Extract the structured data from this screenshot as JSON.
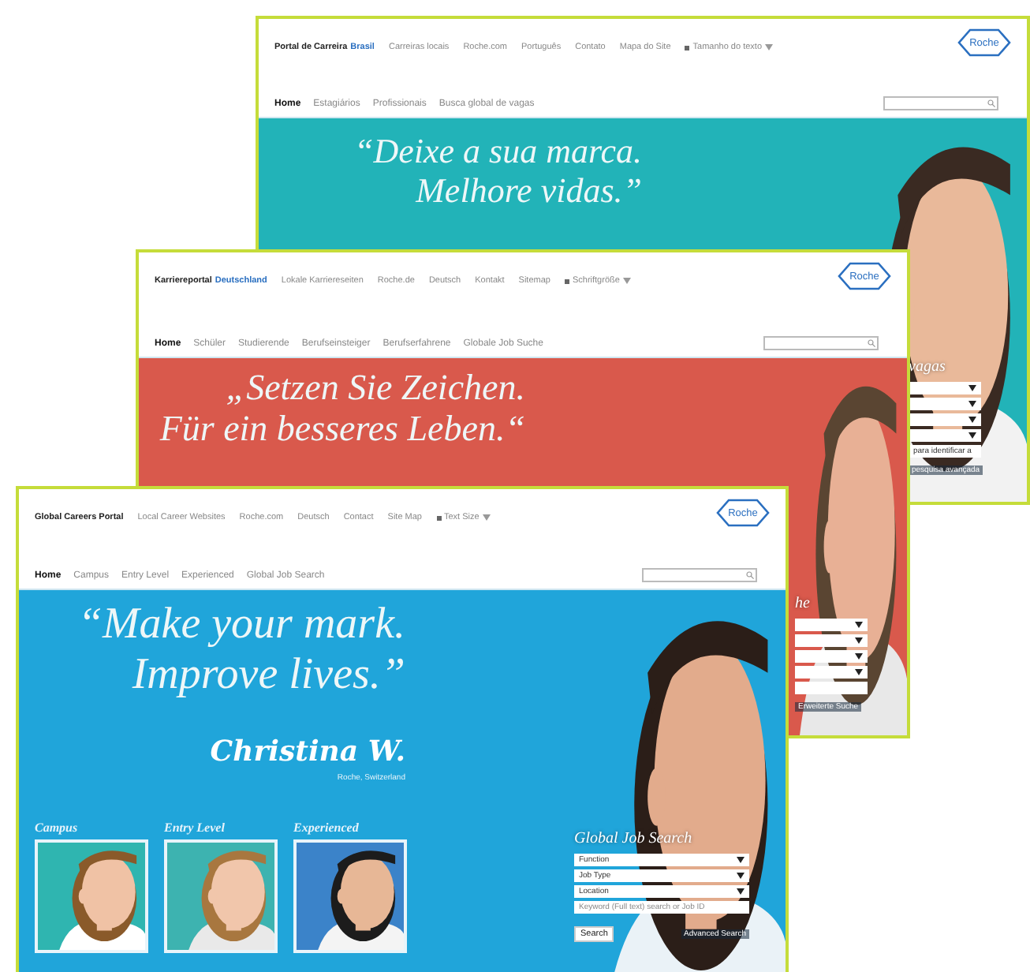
{
  "windows": [
    {
      "portal": "Portal de Carreira",
      "country": "Brasil",
      "top_links": [
        "Carreiras locais",
        "Roche.com",
        "Português",
        "Contato",
        "Mapa do Site"
      ],
      "text_size": "Tamanho do texto",
      "logo": "Roche",
      "nav_tabs": [
        {
          "label": "Home",
          "selected": true
        },
        {
          "label": "Estagiários",
          "selected": false
        },
        {
          "label": "Profissionais",
          "selected": false
        },
        {
          "label": "Busca global de vagas",
          "selected": false
        }
      ],
      "banner": {
        "color": "#22b3b8",
        "quote": [
          "“Deixe a sua marca.",
          "Melhore vidas.”"
        ],
        "job_search": {
          "heading": "vagas",
          "fields": [
            {
              "kind": "dropdown"
            },
            {
              "kind": "dropdown"
            },
            {
              "kind": "dropdown"
            },
            {
              "kind": "dropdown"
            },
            {
              "kind": "text",
              "value": "para identificar a"
            }
          ],
          "link": "pesquisa avançada"
        }
      }
    },
    {
      "portal": "Karriereportal",
      "country": "Deutschland",
      "top_links": [
        "Lokale Karriereseiten",
        "Roche.de",
        "Deutsch",
        "Kontakt",
        "Sitemap"
      ],
      "text_size": "Schriftgröße",
      "logo": "Roche",
      "nav_tabs": [
        {
          "label": "Home",
          "selected": true
        },
        {
          "label": "Schüler",
          "selected": false
        },
        {
          "label": "Studierende",
          "selected": false
        },
        {
          "label": "Berufseinsteiger",
          "selected": false
        },
        {
          "label": "Berufserfahrene",
          "selected": false
        },
        {
          "label": "Globale Job Suche",
          "selected": false
        }
      ],
      "banner": {
        "color": "#d9594c",
        "quote": [
          "„Setzen Sie Zeichen.",
          "Für ein besseres Leben.“"
        ],
        "job_search": {
          "heading": "he",
          "fields": [
            {
              "kind": "dropdown"
            },
            {
              "kind": "dropdown"
            },
            {
              "kind": "dropdown"
            },
            {
              "kind": "dropdown"
            },
            {
              "kind": "text"
            }
          ],
          "link": "Erweiterte Suche"
        }
      }
    },
    {
      "portal": "Global Careers Portal",
      "top_links": [
        "Local Career Websites",
        "Roche.com",
        "Deutsch",
        "Contact",
        "Site Map"
      ],
      "text_size": "Text Size",
      "logo": "Roche",
      "nav_tabs": [
        {
          "label": "Home",
          "selected": true
        },
        {
          "label": "Campus",
          "selected": false
        },
        {
          "label": "Entry Level",
          "selected": false
        },
        {
          "label": "Experienced",
          "selected": false
        },
        {
          "label": "Global Job Search",
          "selected": false
        }
      ],
      "banner": {
        "color": "#20a5da",
        "quote": [
          "“Make your mark.",
          "Improve lives.”"
        ],
        "signature": "Christina W.",
        "signature_place": "Roche, Switzerland",
        "sections": [
          {
            "label": "Campus"
          },
          {
            "label": "Entry Level"
          },
          {
            "label": "Experienced"
          }
        ],
        "job_search": {
          "heading": "Global Job Search",
          "fields": [
            {
              "kind": "dropdown",
              "label": "Function"
            },
            {
              "kind": "dropdown",
              "label": "Job Type"
            },
            {
              "kind": "dropdown",
              "label": "Location"
            },
            {
              "kind": "text",
              "placeholder": "Keyword (Full text) search or Job ID"
            }
          ],
          "button": "Search",
          "link": "Advanced Search"
        }
      }
    }
  ]
}
